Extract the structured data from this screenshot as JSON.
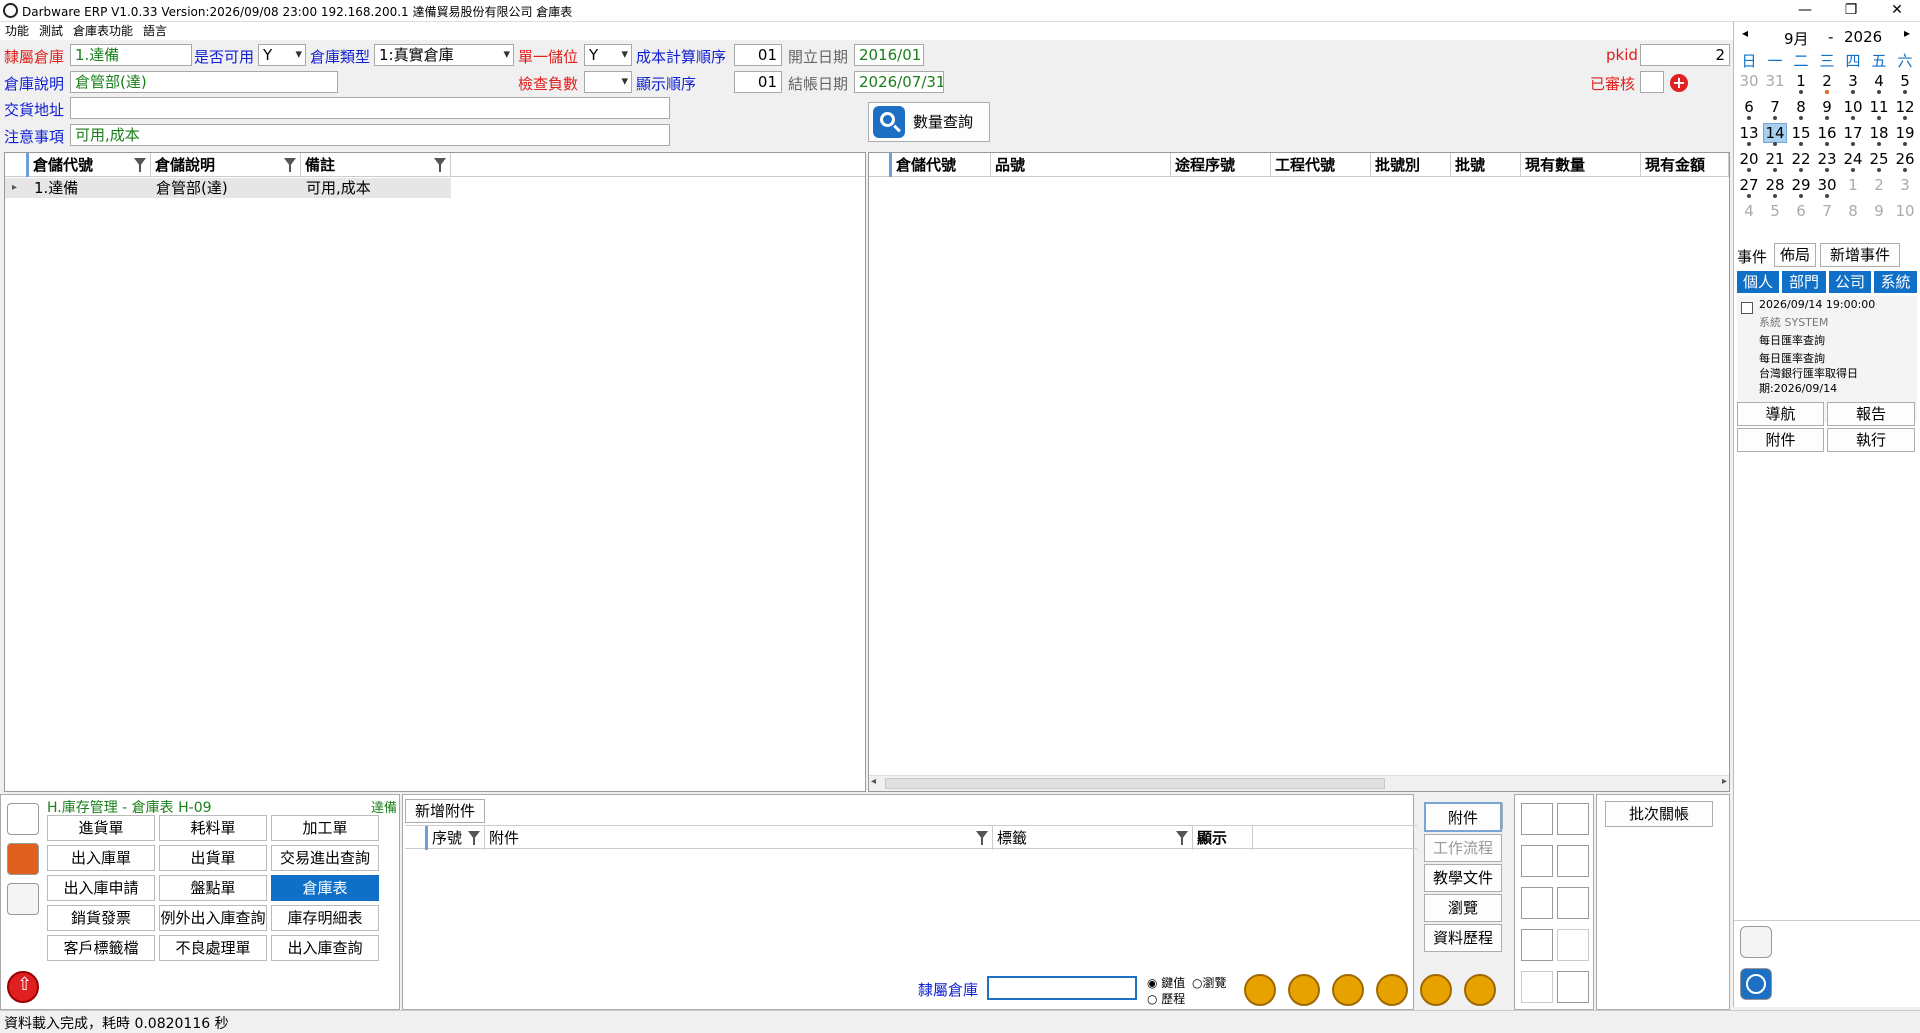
{
  "title": "Darbware ERP V1.0.33 Version:2026/09/08 23:00    192.168.200.1 達備貿易股份有限公司 倉庫表",
  "window": {
    "min": "—",
    "restore": "❐",
    "close": "✕"
  },
  "menu": [
    "功能",
    "測試",
    "倉庫表功能",
    "語言"
  ],
  "form": {
    "warehouse_label": "隸屬倉庫",
    "warehouse_value": "1.達備",
    "usable_label": "是否可用",
    "usable_value": "Y",
    "type_label": "倉庫類型",
    "type_value": "1:真實倉庫",
    "single_label": "單一儲位",
    "single_value": "Y",
    "costorder_label": "成本計算順序",
    "costorder_value": "01",
    "opendate_label": "開立日期",
    "opendate_value": "2016/01",
    "desc_label": "倉庫說明",
    "desc_value": "倉管部(達)",
    "checkneg_label": "檢查負數",
    "checkneg_value": "",
    "disporder_label": "顯示順序",
    "disporder_value": "01",
    "closedate_label": "結帳日期",
    "closedate_value": "2026/07/31",
    "addr_label": "交貨地址",
    "addr_value": "",
    "note_label": "注意事項",
    "note_value": "可用,成本",
    "pkid_label": "pkid",
    "pkid_value": "2",
    "reviewed_label": "已審核",
    "qty_query": "數量查詢"
  },
  "left_grid": {
    "headers": [
      "倉儲代號",
      "倉儲說明",
      "備註"
    ],
    "rows": [
      [
        "1.達備",
        "倉管部(達)",
        "可用,成本"
      ]
    ]
  },
  "right_grid": {
    "headers": [
      "倉儲代號",
      "品號",
      "途程序號",
      "工程代號",
      "批號別",
      "批號",
      "現有數量",
      "現有金額"
    ]
  },
  "calendar": {
    "month": "9月",
    "year": "2026",
    "prev": "◂",
    "next": "▸",
    "sep": "-",
    "weekdays": [
      "日",
      "一",
      "二",
      "三",
      "四",
      "五",
      "六"
    ],
    "weeks": [
      [
        "30",
        "31",
        "1",
        "2",
        "3",
        "4",
        "5"
      ],
      [
        "6",
        "7",
        "8",
        "9",
        "10",
        "11",
        "12"
      ],
      [
        "13",
        "14",
        "15",
        "16",
        "17",
        "18",
        "19"
      ],
      [
        "20",
        "21",
        "22",
        "23",
        "24",
        "25",
        "26"
      ],
      [
        "27",
        "28",
        "29",
        "30",
        "1",
        "2",
        "3"
      ],
      [
        "4",
        "5",
        "6",
        "7",
        "8",
        "9",
        "10"
      ]
    ]
  },
  "events": {
    "label": "事件",
    "layout": "佈局",
    "add": "新增事件",
    "tabs": [
      "個人",
      "部門",
      "公司",
      "系統"
    ],
    "item_time": "2026/09/14 19:00:00",
    "item_owner": "系統  SYSTEM",
    "item_line1": "每日匯率查詢",
    "item_line2": "每日匯率查詢",
    "item_line3": "台灣銀行匯率取得日",
    "item_line4": "期:2026/09/14"
  },
  "side_buttons": [
    "導航",
    "報告",
    "附件",
    "執行"
  ],
  "module": {
    "title": "H.庫存管理 - 倉庫表  H-09",
    "user": "達備",
    "items": [
      "進貨單",
      "耗料單",
      "加工單",
      "出入庫單",
      "出貨單",
      "交易進出查詢",
      "出入庫申請",
      "盤點單",
      "倉庫表",
      "銷貨發票",
      "例外出入庫查詢",
      "庫存明細表",
      "客戶標籤檔",
      "不良處理單",
      "出入庫查詢"
    ]
  },
  "attach": {
    "add": "新增附件",
    "headers": [
      "序號",
      "附件",
      "標籤",
      "顯示"
    ],
    "buttons": [
      "附件",
      "工作流程",
      "教學文件",
      "瀏覽",
      "資料歷程"
    ]
  },
  "search": {
    "label": "隸屬倉庫",
    "opt1": "鍵值",
    "opt2": "瀏覽",
    "opt3": "歷程"
  },
  "batch": "批次關帳",
  "status": "資料載入完成，耗時 0.0820116 秒"
}
